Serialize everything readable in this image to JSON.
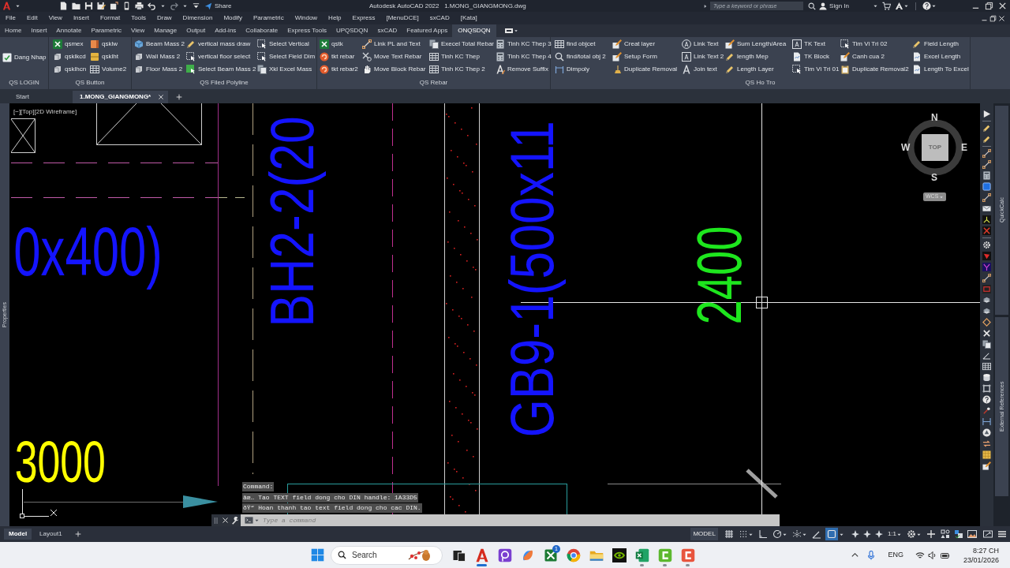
{
  "title_bar": {
    "share": "Share",
    "title": "Autodesk AutoCAD 2022   1.MONG_GIANGMONG.dwg",
    "search": {
      "placeholder": "Type a keyword or phrase"
    },
    "sign_in": "Sign In"
  },
  "menu_bar": [
    "File",
    "Edit",
    "View",
    "Insert",
    "Format",
    "Tools",
    "Draw",
    "Dimension",
    "Modify",
    "Parametric",
    "Window",
    "Help",
    "Express",
    "[MenuDCE]",
    "sxCAD",
    "[Kata]"
  ],
  "ribbon_tabs": [
    {
      "label": "Home",
      "selected": false
    },
    {
      "label": "Insert",
      "selected": false
    },
    {
      "label": "Annotate",
      "selected": false
    },
    {
      "label": "Parametric",
      "selected": false
    },
    {
      "label": "View",
      "selected": false
    },
    {
      "label": "Manage",
      "selected": false
    },
    {
      "label": "Output",
      "selected": false
    },
    {
      "label": "Add-ins",
      "selected": false
    },
    {
      "label": "Collaborate",
      "selected": false
    },
    {
      "label": "Express Tools",
      "selected": false
    },
    {
      "label": "UPQSDQN",
      "selected": false
    },
    {
      "label": "sxCAD",
      "selected": false
    },
    {
      "label": "Featured Apps",
      "selected": false
    },
    {
      "label": "ONQSDQN",
      "selected": true
    }
  ],
  "ribbon_panels": [
    {
      "title": "QS LOGIN",
      "columns": [
        [
          "Dang Nhap"
        ]
      ]
    },
    {
      "title": "QS Button",
      "columns": [
        [
          "qsmex",
          "qsklkcd",
          "qsklhcn"
        ],
        [
          "qsklw",
          "qsklht",
          "Volume2"
        ]
      ]
    },
    {
      "title": "QS Filed Polyline",
      "columns": [
        [
          "Beam Mass 2",
          "Wall Mass 2",
          "Floor Mass 2"
        ],
        [
          "vertical mass draw",
          "vertical floor select",
          "Select Beam Mass 2"
        ],
        [
          "Select Vertical",
          "Select Field Dim",
          "Xkl Excel Mass"
        ]
      ]
    },
    {
      "title": "QS Rebar",
      "columns": [
        [
          "qstk",
          "tkt rebar",
          "tkt rebar2"
        ],
        [
          "Link PL and Text",
          "Move Text Rebar",
          "Move Block Rebar"
        ],
        [
          "Execel Total Rebar",
          "Tinh KC Thep",
          "Tinh KC Thep 2"
        ],
        [
          "Tinh KC Thep 3",
          "Tinh KC Thep 4",
          "Remove Suffix"
        ]
      ]
    },
    {
      "title": "QS Ho Tro",
      "columns": [
        [
          "find objcet",
          "find/total obj 2",
          "Dimpoly"
        ],
        [
          "Creat layer",
          "Setup Form",
          "Duplicate Removal"
        ],
        [
          "Link Text",
          "Link Text 2",
          "Join text"
        ],
        [
          "Sum Length/Area",
          "length Mep",
          "Length Layer"
        ],
        [
          "TK Text",
          "TK Block",
          "Tim Vi Tri 01"
        ],
        [
          "Tim Vi Tri 02",
          "Canh cua 2",
          "Duplicate Removal2"
        ],
        [
          "Field Length",
          "Excel Length",
          "Length To Excel"
        ]
      ]
    }
  ],
  "file_tabs": [
    {
      "label": "Start",
      "selected": false
    },
    {
      "label": "1.MONG_GIANGMONG*",
      "selected": true
    }
  ],
  "viewport": {
    "label": "[−][Top][2D Wireframe]",
    "texts": [
      {
        "text": "0x400)",
        "color": "#1414ff",
        "vertical": false
      },
      {
        "text": "BH2-2(20",
        "color": "#1414ff",
        "vertical": true
      },
      {
        "text": "GB9-1(500x11",
        "color": "#1414ff",
        "vertical": true
      },
      {
        "text": "2400",
        "color": "#1ee61e",
        "vertical": true
      },
      {
        "text": "3000",
        "color": "#ffff00",
        "vertical": false
      }
    ],
    "view_cube": {
      "face": "TOP",
      "north": "N",
      "south": "S",
      "east": "E",
      "west": "W",
      "ucs": "WCS"
    }
  },
  "palettes": {
    "left": "Properties",
    "right": [
      "QuickCalc",
      "External References"
    ]
  },
  "command_line": {
    "history": [
      "Command:",
      "âœ… Tao TEXT field dong cho DIN handle: 1A33D5",
      "ðŸ“ Hoan thanh tao text field dong cho cac DIN."
    ],
    "placeholder": "Type a command"
  },
  "layout_tabs": [
    {
      "label": "Model",
      "selected": true
    },
    {
      "label": "Layout1",
      "selected": false
    }
  ],
  "status_bar": {
    "space": "MODEL",
    "scale": "1:1",
    "toggles": [
      {
        "on": false
      },
      {
        "on": false
      },
      {
        "on": false
      },
      {
        "on": false
      },
      {
        "on": false
      },
      {
        "on": false
      },
      {
        "on": true
      }
    ]
  },
  "taskbar": {
    "search": {
      "placeholder": "Search"
    },
    "apps": [
      {
        "selected": false,
        "running": false
      },
      {
        "selected": true,
        "running": true
      },
      {
        "selected": false,
        "running": false
      },
      {
        "selected": false,
        "running": false
      },
      {
        "selected": false,
        "running": false,
        "badge": "1"
      },
      {
        "selected": false,
        "running": false
      },
      {
        "selected": false,
        "running": false
      },
      {
        "selected": false,
        "running": false
      },
      {
        "selected": false,
        "running": true
      },
      {
        "selected": false,
        "running": true
      },
      {
        "selected": false,
        "running": true
      }
    ],
    "language": "ENG",
    "time": "8:27 CH",
    "date": "23/01/2026"
  }
}
